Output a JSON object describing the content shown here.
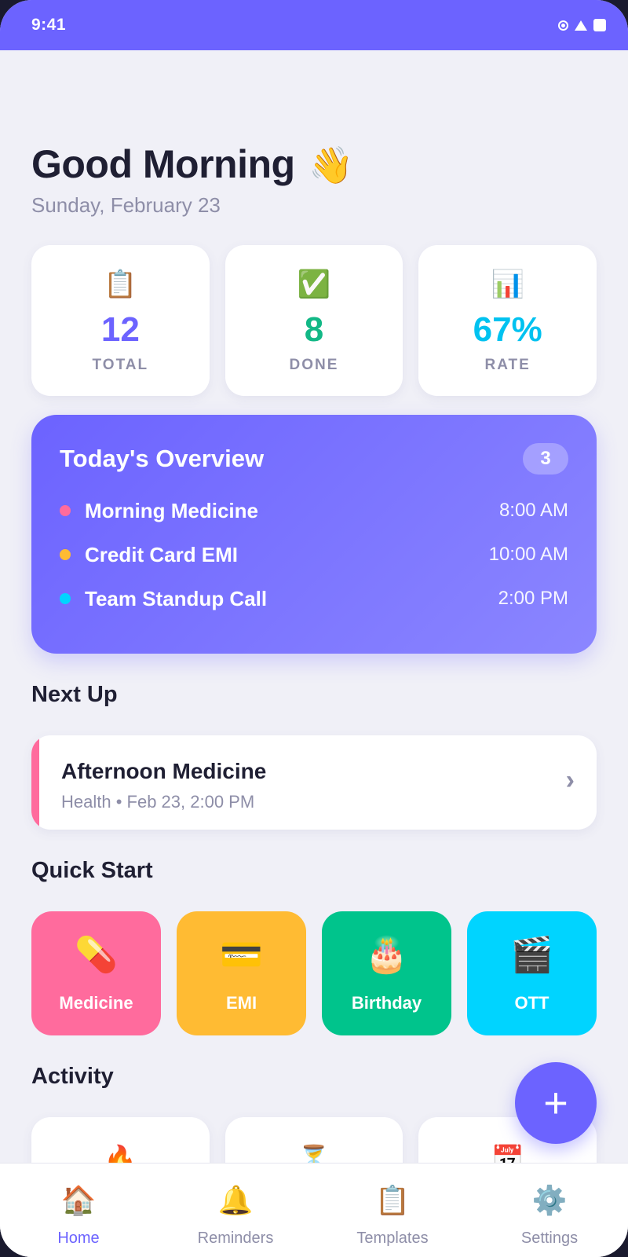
{
  "status_bar": {
    "time": "9:41"
  },
  "header": {
    "greeting": "Good Morning",
    "wave_emoji": "👋",
    "date": "Sunday, February 23"
  },
  "stats": [
    {
      "icon": "📋",
      "icon_name": "clipboard-icon",
      "value": "12",
      "label": "TOTAL",
      "color": "#6c63ff"
    },
    {
      "icon": "✅",
      "icon_name": "check-icon",
      "value": "8",
      "label": "DONE",
      "color": "#12b886"
    },
    {
      "icon": "📊",
      "icon_name": "chart-icon",
      "value": "67%",
      "label": "RATE",
      "color": "#00c2f0"
    }
  ],
  "overview": {
    "title": "Today's Overview",
    "count": "3",
    "items": [
      {
        "name": "Morning Medicine",
        "time": "8:00 AM",
        "dot_color": "#ff6b9d"
      },
      {
        "name": "Credit Card EMI",
        "time": "10:00 AM",
        "dot_color": "#ffbb33"
      },
      {
        "name": "Team Standup Call",
        "time": "2:00 PM",
        "dot_color": "#00d4ff"
      }
    ]
  },
  "next_up": {
    "section_title": "Next Up",
    "title": "Afternoon Medicine",
    "subtitle": "Health • Feb 23, 2:00 PM",
    "chevron": "›",
    "accent_color": "#ff6b9d"
  },
  "quick_start": {
    "section_title": "Quick Start",
    "items": [
      {
        "icon": "💊",
        "icon_name": "pill-icon",
        "label": "Medicine",
        "color": "#ff6b9d"
      },
      {
        "icon": "💳",
        "icon_name": "credit-card-icon",
        "label": "EMI",
        "color": "#ffbb33"
      },
      {
        "icon": "🎂",
        "icon_name": "cake-icon",
        "label": "Birthday",
        "color": "#00c48c"
      },
      {
        "icon": "🎬",
        "icon_name": "clapper-icon",
        "label": "OTT",
        "color": "#00d4ff"
      }
    ]
  },
  "activity": {
    "section_title": "Activity",
    "items": [
      {
        "icon": "🔥",
        "icon_name": "fire-icon"
      },
      {
        "icon": "⏳",
        "icon_name": "hourglass-icon"
      },
      {
        "icon": "📅",
        "icon_name": "calendar-icon"
      }
    ]
  },
  "fab": {
    "symbol": "+"
  },
  "nav": {
    "items": [
      {
        "icon": "🏠",
        "icon_name": "home-icon",
        "label": "Home",
        "active": true
      },
      {
        "icon": "🔔",
        "icon_name": "bell-icon",
        "label": "Reminders",
        "active": false
      },
      {
        "icon": "📋",
        "icon_name": "clipboard-icon",
        "label": "Templates",
        "active": false
      },
      {
        "icon": "⚙️",
        "icon_name": "gear-icon",
        "label": "Settings",
        "active": false
      }
    ]
  },
  "colors": {
    "accent": "#6c63ff",
    "background": "#f0f0f7",
    "muted_text": "#8e8ea8"
  }
}
